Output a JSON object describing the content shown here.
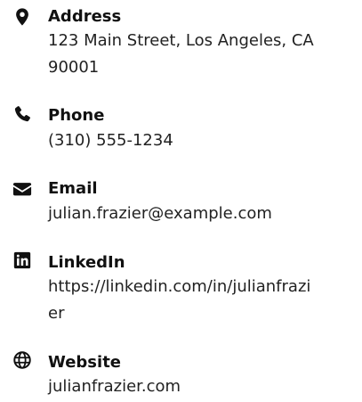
{
  "contacts": [
    {
      "icon": "map-marker-icon",
      "label": "Address",
      "value_lines": [
        "123 Main Street, Los Angeles, CA",
        "90001"
      ]
    },
    {
      "icon": "phone-icon",
      "label": "Phone",
      "value_lines": [
        "(310) 555-1234"
      ]
    },
    {
      "icon": "envelope-icon",
      "label": "Email",
      "value_lines": [
        "julian.frazier@example.com"
      ]
    },
    {
      "icon": "linkedin-icon",
      "label": "LinkedIn",
      "value_lines": [
        "https://linkedin.com/in/julianfrazi",
        "er"
      ]
    },
    {
      "icon": "globe-icon",
      "label": "Website",
      "value_lines": [
        "julianfrazier.com"
      ]
    }
  ]
}
